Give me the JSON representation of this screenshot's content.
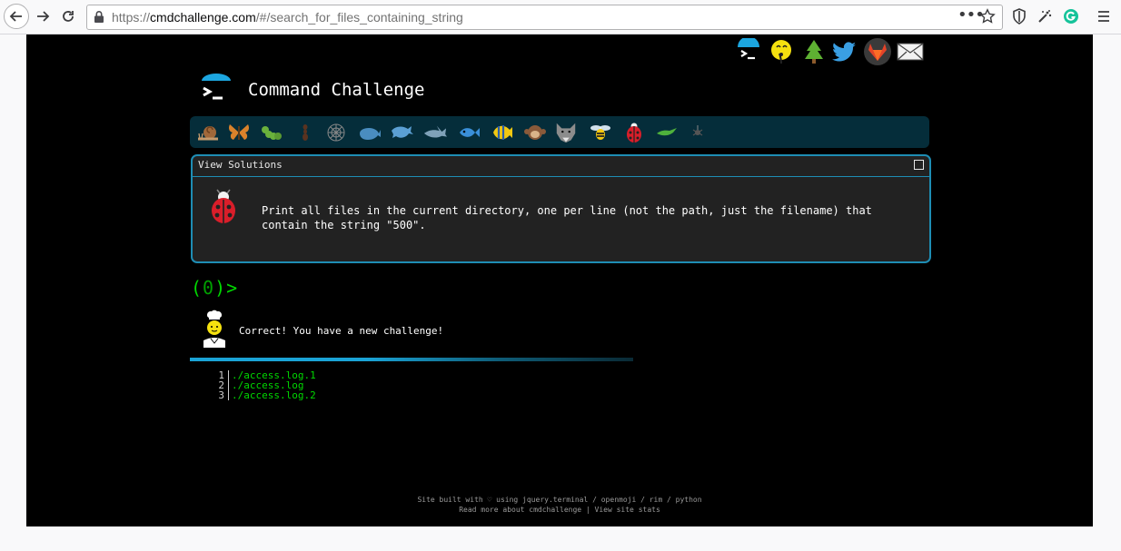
{
  "browser": {
    "url_prefix": "https://",
    "url_host": "cmdchallenge.com",
    "url_path": "/#/search_for_files_containing_string",
    "more_glyph": "•••"
  },
  "page": {
    "title": "Command Challenge",
    "panel": {
      "title": "View Solutions",
      "challenge_text": "Print all files in the current directory, one per line (not the path, just the filename) that\ncontain the string \"500\"."
    },
    "prompt": {
      "open": "(",
      "count": "0",
      "close": ")>"
    },
    "result_message": "Correct! You have a new challenge!",
    "progress": 1.0,
    "output_lines": [
      {
        "num": "1",
        "text": "./access.log.1"
      },
      {
        "num": "2",
        "text": "./access.log"
      },
      {
        "num": "3",
        "text": "./access.log.2"
      }
    ],
    "footer": {
      "line1": "Site built with ♡ using jquery.terminal / openmoji / rim / python",
      "line2": "Read more about cmdchallenge | View site stats"
    }
  },
  "social_icons": [
    "cmdchallenge-logo-icon",
    "fortune-icon",
    "tree-icon",
    "twitter-icon",
    "gitlab-icon",
    "envelope-icon"
  ],
  "level_icons": [
    "snail-icon",
    "butterfly-icon",
    "caterpillar-icon",
    "ant-icon",
    "web-icon",
    "whale-icon",
    "dolphin-icon",
    "shark-icon",
    "fish-icon",
    "tropical-fish-icon",
    "monkey-icon",
    "wolf-icon",
    "bee-icon",
    "ladybug-icon",
    "lizard-icon",
    "spider-icon"
  ],
  "colors": {
    "accent": "#1e8db4",
    "terminal_green": "#00d700",
    "level_bar": "#052d3a"
  }
}
